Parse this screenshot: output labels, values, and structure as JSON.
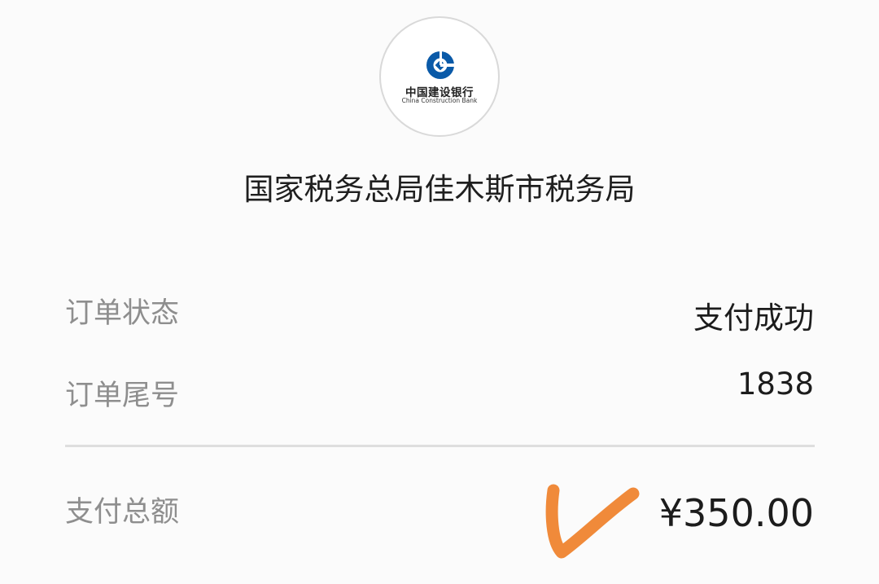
{
  "bank": {
    "name_cn": "中国建设银行",
    "name_en": "China Construction Bank",
    "accent_color": "#0a5aa8"
  },
  "merchant": {
    "name": "国家税务总局佳木斯市税务局"
  },
  "order": {
    "status_label": "订单状态",
    "status_value": "支付成功",
    "tail_label": "订单尾号",
    "tail_value": "1838",
    "total_label": "支付总额",
    "total_value": "¥350.00"
  },
  "annotation": {
    "check_color": "#f08a3a"
  }
}
